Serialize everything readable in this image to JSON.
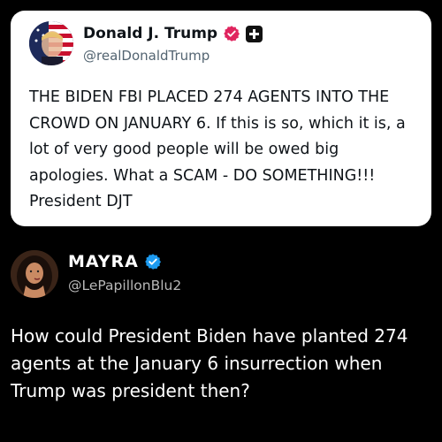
{
  "tweet": {
    "author_name": "Donald J. Trump",
    "handle": "@realDonaldTrump",
    "text": "THE BIDEN FBI PLACED 274 AGENTS INTO THE CROWD ON JANUARY 6. If this is so, which it is, a lot of very good people will be owed big apologies. What a SCAM - DO SOMETHING!!! President DJT",
    "verified_color": "#e0245e",
    "icons": [
      "flag-avatar",
      "verified-badge-icon",
      "plus-icon"
    ]
  },
  "reply": {
    "author_name": "MAYRA",
    "handle": "@LePapillonBlu2",
    "text": "How could President Biden have planted 274 agents at the January 6 insurrection when Trump was president then?",
    "verified_color": "#1d9bf0",
    "icons": [
      "avatar",
      "verified-badge-icon"
    ]
  },
  "colors": {
    "background": "#000000",
    "card": "#ffffff"
  }
}
